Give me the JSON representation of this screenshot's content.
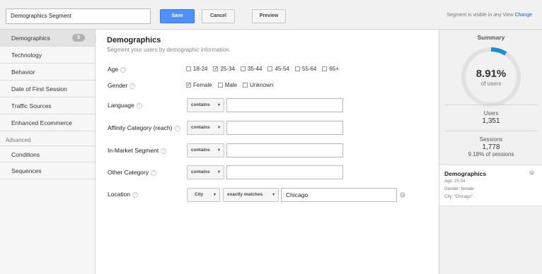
{
  "header": {
    "segment_name": "Demographics Segment",
    "save_label": "Save",
    "cancel_label": "Cancel",
    "preview_label": "Preview",
    "visibility_text": "Segment is visible in any View",
    "change_label": "Change"
  },
  "sidebar": {
    "items": [
      {
        "label": "Demographics",
        "badge": "3",
        "active": true
      },
      {
        "label": "Technology"
      },
      {
        "label": "Behavior"
      },
      {
        "label": "Date of First Session"
      },
      {
        "label": "Traffic Sources"
      },
      {
        "label": "Enhanced Ecommerce"
      }
    ],
    "advanced_label": "Advanced",
    "advanced_items": [
      {
        "label": "Conditions"
      },
      {
        "label": "Sequences"
      }
    ]
  },
  "main": {
    "title": "Demographics",
    "subtitle": "Segment your users by demographic information.",
    "age": {
      "label": "Age",
      "options": [
        {
          "label": "18-24",
          "checked": false
        },
        {
          "label": "25-34",
          "checked": true
        },
        {
          "label": "35-44",
          "checked": false
        },
        {
          "label": "45-54",
          "checked": false
        },
        {
          "label": "55-64",
          "checked": false
        },
        {
          "label": "65+",
          "checked": false
        }
      ]
    },
    "gender": {
      "label": "Gender",
      "options": [
        {
          "label": "Female",
          "checked": true
        },
        {
          "label": "Male",
          "checked": false
        },
        {
          "label": "Unknown",
          "checked": false
        }
      ]
    },
    "language": {
      "label": "Language",
      "operator": "contains",
      "value": ""
    },
    "affinity": {
      "label": "Affinity Category (reach)",
      "operator": "contains",
      "value": ""
    },
    "in_market": {
      "label": "In-Market Segment",
      "operator": "contains",
      "value": ""
    },
    "other": {
      "label": "Other Category",
      "operator": "contains",
      "value": ""
    },
    "location": {
      "label": "Location",
      "dimension": "City",
      "operator": "exactly matches",
      "value": "Chicago"
    }
  },
  "summary": {
    "title": "Summary",
    "percent": "8.91%",
    "percent_fraction": 0.0891,
    "percent_sub": "of users",
    "users_label": "Users",
    "users_value": "1,351",
    "sessions_label": "Sessions",
    "sessions_value": "1,778",
    "sessions_sub": "9.18% of sessions",
    "card": {
      "title": "Demographics",
      "lines": [
        "Age: 25-34",
        "Gender: female",
        "City: \"Chicago\""
      ]
    }
  },
  "colors": {
    "accent": "#4d90fe",
    "gauge_fill": "#1a8fd9",
    "gauge_track": "#e1e1e1"
  }
}
